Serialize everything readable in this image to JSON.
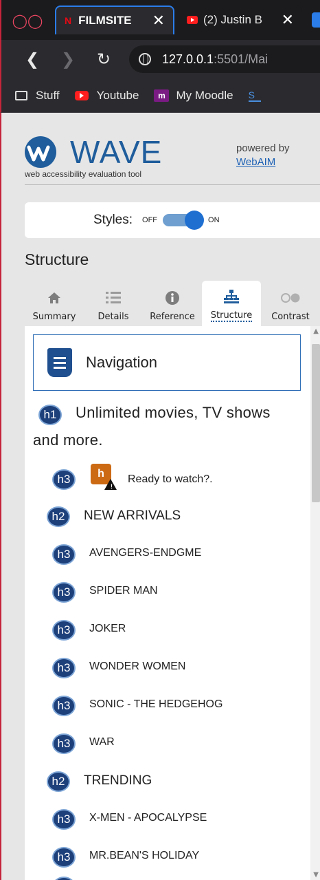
{
  "browser": {
    "tabs": [
      {
        "title": "FILMSITE",
        "active": true
      },
      {
        "title": "(2) Justin B",
        "active": false
      }
    ],
    "url": {
      "host": "127.0.0.1",
      "path": ":5501/Mai"
    },
    "bookmarks": [
      "Stuff",
      "Youtube",
      "My Moodle"
    ]
  },
  "wave": {
    "wordmark": "WAVE",
    "tagline": "web accessibility evaluation tool",
    "powered_by": "powered by",
    "webaim_link": "WebAIM",
    "styles_label": "Styles:",
    "styles_off": "OFF",
    "styles_on": "ON",
    "section_title": "Structure",
    "tabs": [
      {
        "label": "Summary",
        "icon": "home-icon"
      },
      {
        "label": "Details",
        "icon": "list-icon"
      },
      {
        "label": "Reference",
        "icon": "info-icon"
      },
      {
        "label": "Structure",
        "icon": "hierarchy-icon",
        "selected": true
      },
      {
        "label": "Contrast",
        "icon": "contrast-icon"
      }
    ],
    "structure": {
      "navigation_label": "Navigation",
      "headings": [
        {
          "level": "h1",
          "text_line1": "Unlimited movies, TV shows",
          "text_line2": "and more."
        },
        {
          "level": "h3",
          "text": "Ready to watch?.",
          "alert": true
        },
        {
          "level": "h2",
          "text": "NEW ARRIVALS"
        },
        {
          "level": "h3",
          "text": "AVENGERS-ENDGME"
        },
        {
          "level": "h3",
          "text": "SPIDER MAN"
        },
        {
          "level": "h3",
          "text": "JOKER"
        },
        {
          "level": "h3",
          "text": "WONDER WOMEN"
        },
        {
          "level": "h3",
          "text": "SONIC - THE HEDGEHOG"
        },
        {
          "level": "h3",
          "text": "WAR"
        },
        {
          "level": "h2",
          "text": "TRENDING"
        },
        {
          "level": "h3",
          "text": "X-MEN - APOCALYPSE"
        },
        {
          "level": "h3",
          "text": "MR.BEAN'S HOLIDAY"
        }
      ],
      "alert_badge": "h"
    }
  }
}
